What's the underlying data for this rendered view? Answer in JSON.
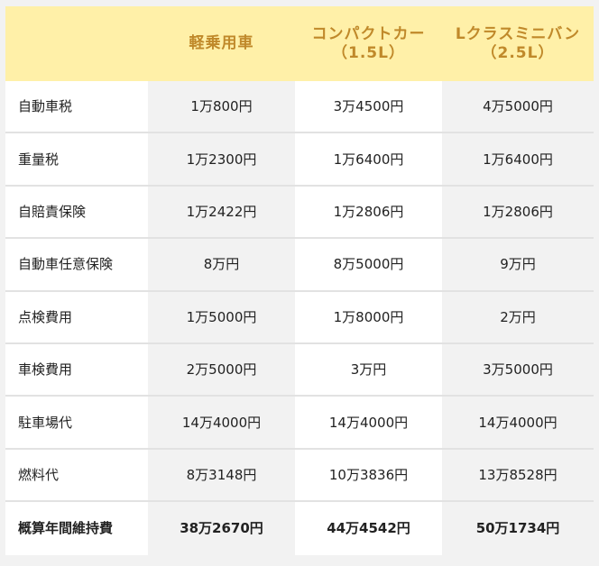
{
  "header": {
    "label": "",
    "columns": [
      {
        "line1": "軽乗用車",
        "line2": ""
      },
      {
        "line1": "コンパクトカー",
        "line2": "（1.5L）"
      },
      {
        "line1": "Lクラスミニバン",
        "line2": "（2.5L）"
      }
    ]
  },
  "rows": [
    {
      "label": "自動車税",
      "values": [
        "1万800円",
        "3万4500円",
        "4万5000円"
      ]
    },
    {
      "label": "重量税",
      "values": [
        "1万2300円",
        "1万6400円",
        "1万6400円"
      ]
    },
    {
      "label": "自賠責保険",
      "values": [
        "1万2422円",
        "1万2806円",
        "1万2806円"
      ]
    },
    {
      "label": "自動車任意保険",
      "values": [
        "8万円",
        "8万5000円",
        "9万円"
      ]
    },
    {
      "label": "点検費用",
      "values": [
        "1万5000円",
        "1万8000円",
        "2万円"
      ]
    },
    {
      "label": "車検費用",
      "values": [
        "2万5000円",
        "3万円",
        "3万5000円"
      ]
    },
    {
      "label": "駐車場代",
      "values": [
        "14万4000円",
        "14万4000円",
        "14万4000円"
      ]
    },
    {
      "label": "燃料代",
      "values": [
        "8万3148円",
        "10万3836円",
        "13万8528円"
      ]
    },
    {
      "label": "概算年間維持費",
      "values": [
        "38万2670円",
        "44万4542円",
        "50万1734円"
      ]
    }
  ],
  "colors": {
    "header_bg": "#fff0a8",
    "header_text": "#c0892a",
    "row_alt_bg": "#f2f2f2",
    "row_bg": "#ffffff",
    "divider": "#e2e2e2"
  }
}
